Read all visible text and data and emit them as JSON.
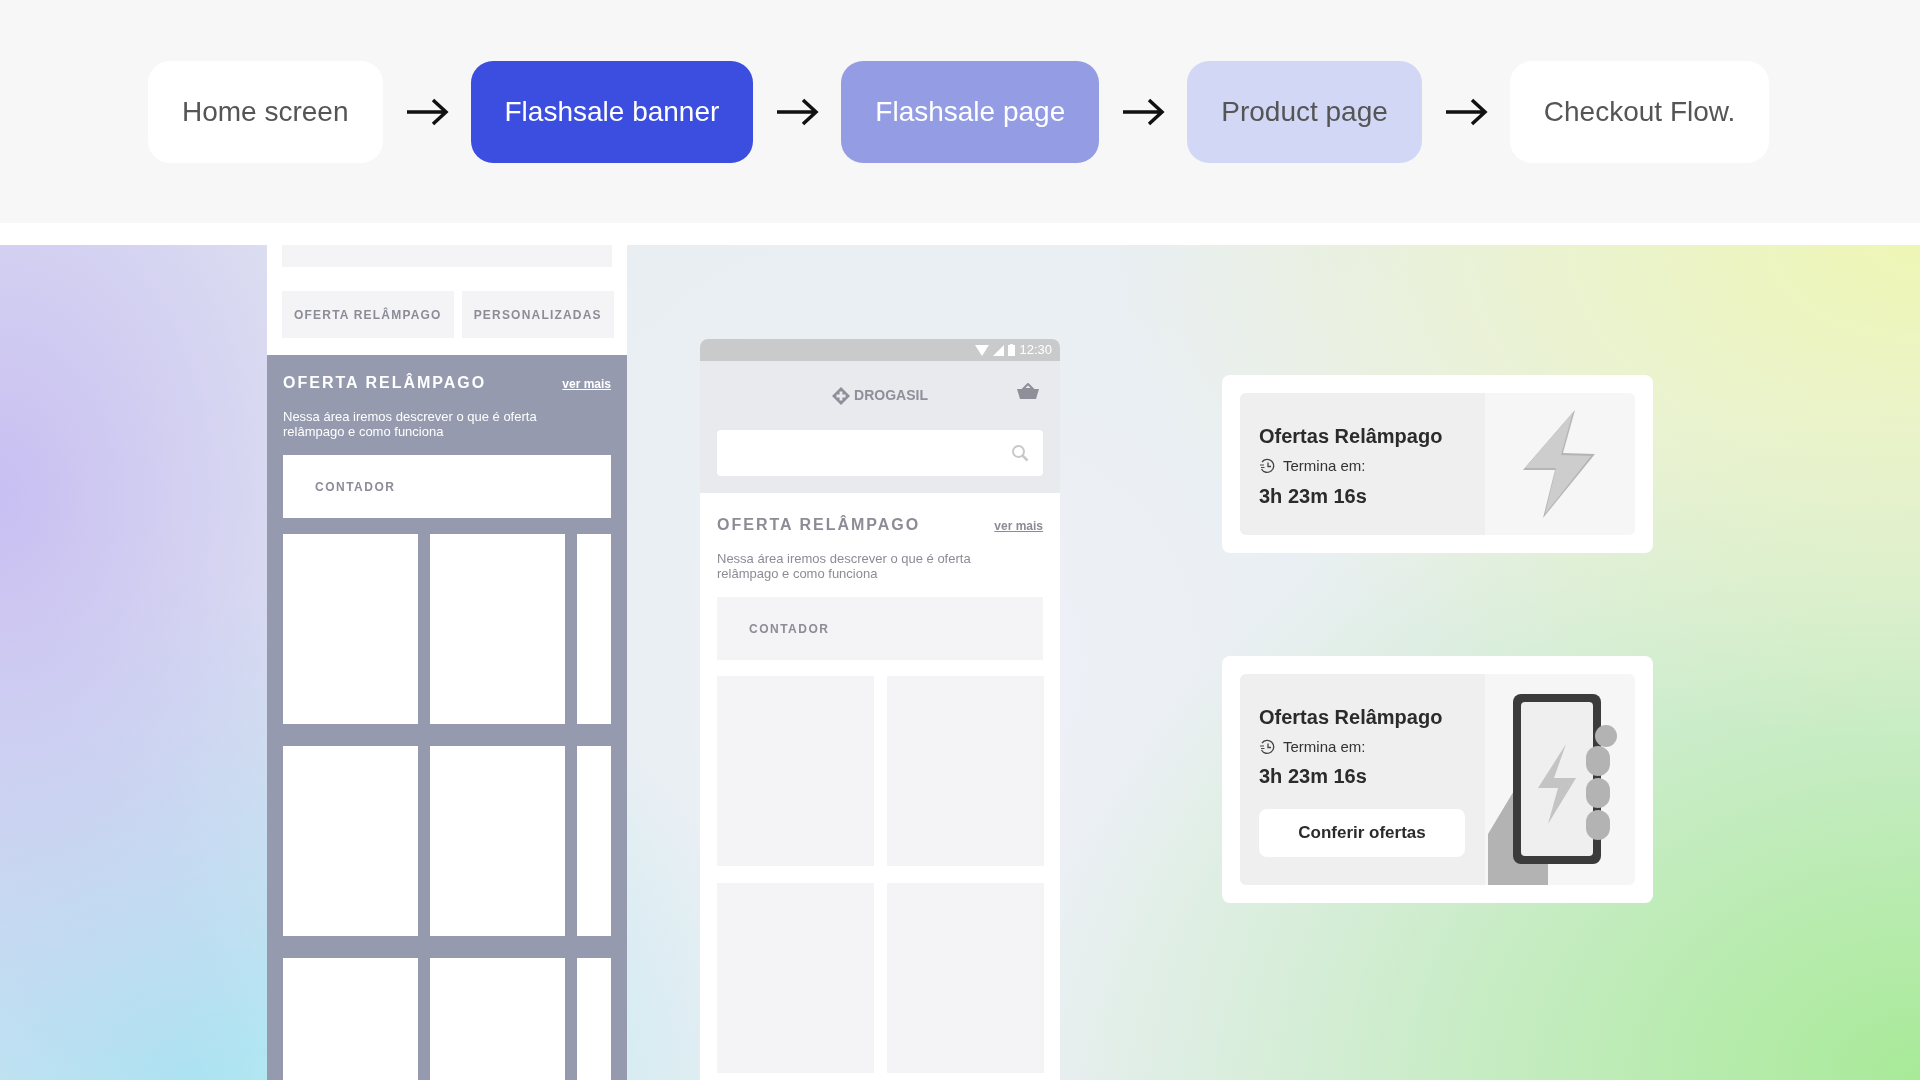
{
  "flow": [
    {
      "label": "Home screen",
      "kind": "plain"
    },
    {
      "label": "Flashsale banner",
      "kind": "strong"
    },
    {
      "label": "Flashsale page",
      "kind": "medium"
    },
    {
      "label": "Product page",
      "kind": "light"
    },
    {
      "label": "Checkout Flow.",
      "kind": "plain"
    }
  ],
  "wireframe_scroll": {
    "tabs": [
      {
        "label": "OFERTA RELÂMPAGO"
      },
      {
        "label": "PERSONALIZADAS"
      }
    ],
    "section": {
      "title": "OFERTA RELÂMPAGO",
      "link": "ver mais",
      "description": "Nessa área iremos descrever o que é oferta relâmpago e como funciona",
      "counter": "CONTADOR"
    }
  },
  "wireframe_home": {
    "status_time": "12:30",
    "brand": "DROGASIL",
    "section": {
      "title": "OFERTA RELÂMPAGO",
      "link": "ver mais",
      "description": "Nessa área iremos descrever o que é oferta relâmpago e como funciona",
      "counter": "CONTADOR"
    }
  },
  "banners": [
    {
      "title": "Ofertas Relâmpago",
      "ends_label": "Termina em:",
      "time": "3h 23m 16s",
      "kind": "bolt"
    },
    {
      "title": "Ofertas Relâmpago",
      "ends_label": "Termina em:",
      "time": "3h 23m 16s",
      "button": "Conferir ofertas",
      "kind": "phone"
    }
  ]
}
